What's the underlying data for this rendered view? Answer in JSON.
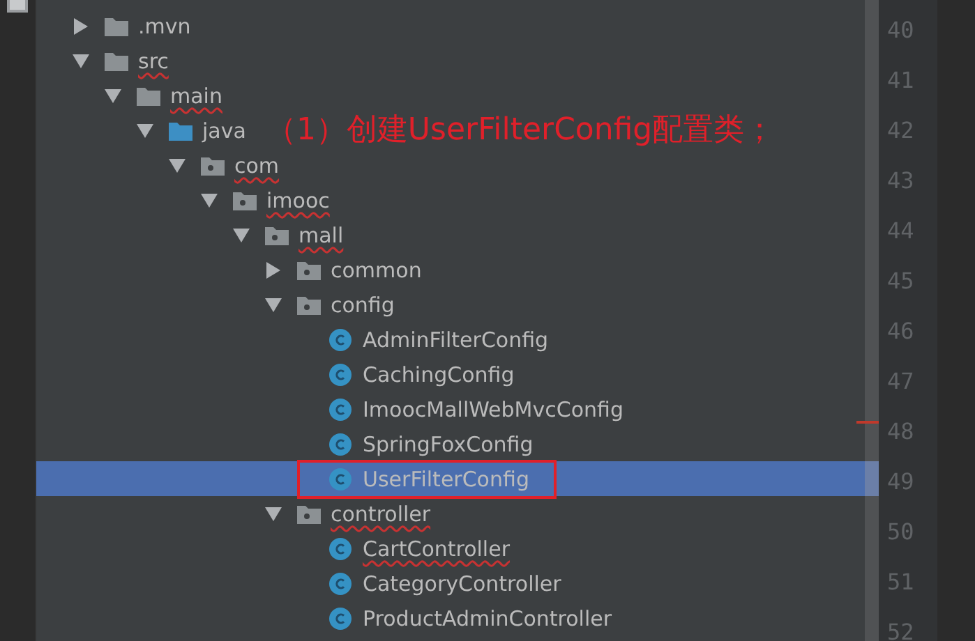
{
  "tree": [
    {
      "label": ".mvn",
      "kind": "folder",
      "expanded": false,
      "error_underline": false,
      "selected": false
    },
    {
      "label": "src",
      "kind": "folder",
      "expanded": true,
      "error_underline": true,
      "selected": false,
      "children": [
        {
          "label": "main",
          "kind": "folder",
          "expanded": true,
          "error_underline": true,
          "selected": false,
          "children": [
            {
              "label": "java",
              "kind": "source-folder",
              "expanded": true,
              "error_underline": false,
              "selected": false,
              "annotation": "（1）创建UserFilterConfig配置类；",
              "children": [
                {
                  "label": "com",
                  "kind": "package",
                  "expanded": true,
                  "error_underline": true,
                  "selected": false,
                  "children": [
                    {
                      "label": "imooc",
                      "kind": "package",
                      "expanded": true,
                      "error_underline": true,
                      "selected": false,
                      "children": [
                        {
                          "label": "mall",
                          "kind": "package",
                          "expanded": true,
                          "error_underline": true,
                          "selected": false,
                          "children": [
                            {
                              "label": "common",
                              "kind": "package",
                              "expanded": false,
                              "error_underline": false,
                              "selected": false
                            },
                            {
                              "label": "config",
                              "kind": "package",
                              "expanded": true,
                              "error_underline": false,
                              "selected": false,
                              "children": [
                                {
                                  "label": "AdminFilterConfig",
                                  "kind": "class",
                                  "error_underline": false,
                                  "selected": false
                                },
                                {
                                  "label": "CachingConfig",
                                  "kind": "class",
                                  "error_underline": false,
                                  "selected": false
                                },
                                {
                                  "label": "ImoocMallWebMvcConfig",
                                  "kind": "class",
                                  "error_underline": false,
                                  "selected": false
                                },
                                {
                                  "label": "SpringFoxConfig",
                                  "kind": "class",
                                  "error_underline": false,
                                  "selected": false
                                },
                                {
                                  "label": "UserFilterConfig",
                                  "kind": "class",
                                  "error_underline": false,
                                  "selected": true,
                                  "boxed": true
                                }
                              ]
                            },
                            {
                              "label": "controller",
                              "kind": "package",
                              "expanded": true,
                              "error_underline": true,
                              "selected": false,
                              "children": [
                                {
                                  "label": "CartController",
                                  "kind": "class",
                                  "error_underline": true,
                                  "selected": false
                                },
                                {
                                  "label": "CategoryController",
                                  "kind": "class",
                                  "error_underline": false,
                                  "selected": false
                                },
                                {
                                  "label": "ProductAdminController",
                                  "kind": "class",
                                  "error_underline": false,
                                  "selected": false
                                }
                              ]
                            }
                          ]
                        }
                      ]
                    }
                  ]
                }
              ]
            }
          ]
        }
      ]
    }
  ],
  "line_numbers": [
    "40",
    "41",
    "42",
    "43",
    "44",
    "45",
    "46",
    "47",
    "48",
    "49",
    "50",
    "51",
    "52"
  ]
}
